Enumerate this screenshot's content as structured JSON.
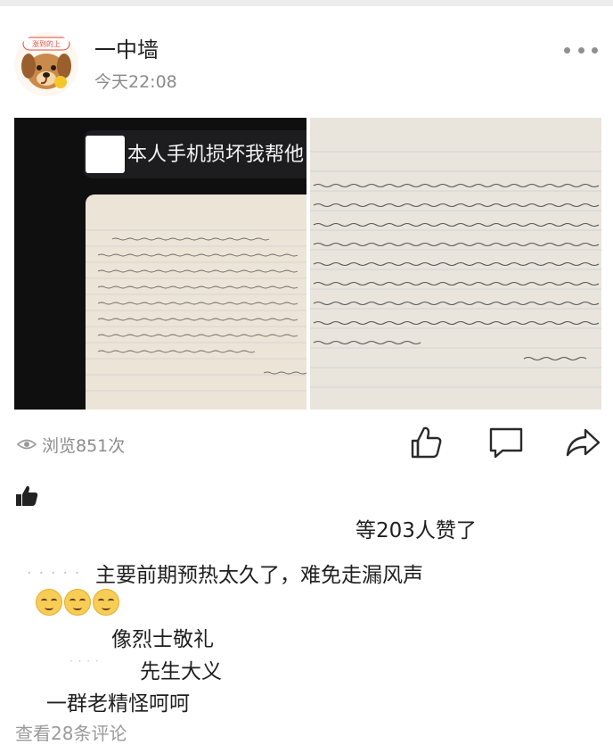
{
  "post": {
    "username": "一中墙",
    "timestamp": "今天22:08",
    "avatar_badge": "涨到的上",
    "image_caption": "本人手机损坏我帮他",
    "views": "浏览851次"
  },
  "icons": {
    "more": "more-dots-icon",
    "eye": "eye-icon",
    "like": "thumbs-up-icon",
    "comment": "comment-icon",
    "share": "share-icon",
    "like_filled": "thumbs-up-filled-icon",
    "emoji": "grinning-face-emoji"
  },
  "likes": {
    "text": "等203人赞了"
  },
  "comments": [
    {
      "text": "主要前期预热太久了，难免走漏风声"
    },
    {
      "text": "像烈士敬礼"
    },
    {
      "text": "先生大义"
    },
    {
      "text": "一群老精怪呵呵"
    }
  ],
  "view_all_comments": "查看28条评论",
  "colors": {
    "muted_text": "#8a8a8a",
    "emoji_yellow": "#f7cd56"
  }
}
